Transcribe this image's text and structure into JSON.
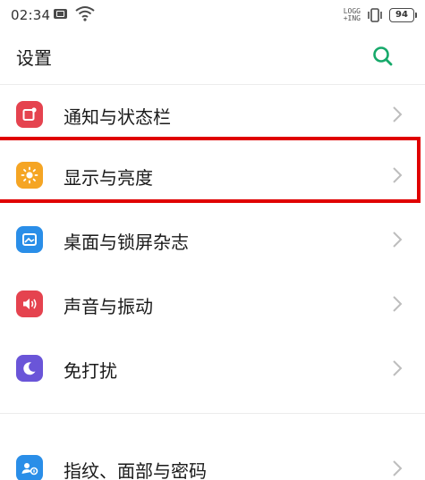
{
  "status_bar": {
    "time": "02:34",
    "network_text_line1": "LOGG",
    "network_text_line2": "+ING",
    "battery": "94",
    "icons": [
      "message-icon",
      "wifi-icon",
      "vibrate-icon",
      "battery-icon"
    ]
  },
  "header": {
    "title": "设置",
    "search_icon": "search-icon",
    "accent_color": "#16a96a"
  },
  "settings": {
    "items": [
      {
        "label": "通知与状态栏",
        "icon": "notification-icon",
        "color": "#e5434f"
      },
      {
        "label": "显示与亮度",
        "icon": "sun-icon",
        "color": "#f5a524"
      },
      {
        "label": "桌面与锁屏杂志",
        "icon": "wallpaper-icon",
        "color": "#2a8ee8"
      },
      {
        "label": "声音与振动",
        "icon": "speaker-icon",
        "color": "#e5434f"
      },
      {
        "label": "免打扰",
        "icon": "moon-icon",
        "color": "#6a55d8"
      },
      {
        "label": "指纹、面部与密码",
        "icon": "fingerprint-user-icon",
        "color": "#2a8ee8"
      }
    ]
  },
  "highlight": {
    "target": "显示与亮度",
    "color": "#e00000"
  }
}
